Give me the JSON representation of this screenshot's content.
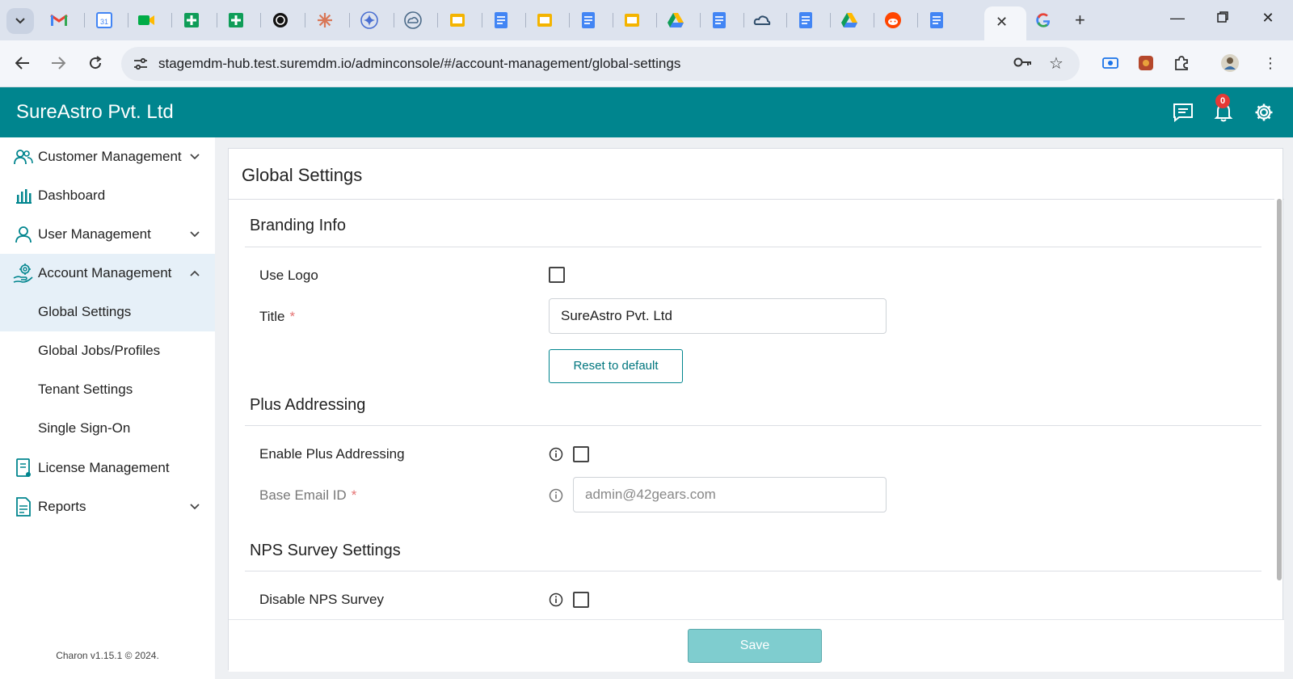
{
  "browser": {
    "url": "stagemdm-hub.test.suremdm.io/adminconsole/#/account-management/global-settings",
    "tab_favicons": [
      "gmail-icon",
      "calendar-icon",
      "meet-icon",
      "sheets-icon",
      "sheets-icon",
      "openai-icon",
      "claude-icon",
      "gemini-icon",
      "cloud-icon",
      "slides-icon",
      "docs-icon",
      "slides-icon",
      "docs-icon",
      "slides-icon",
      "drive-icon",
      "docs-icon",
      "cloud-icon",
      "docs-icon",
      "drive-icon",
      "reddit-icon",
      "docs-icon"
    ],
    "calendar_day": "31"
  },
  "app": {
    "brand": "SureAstro Pvt. Ltd",
    "notification_count": "0",
    "accent_color": "#00858e"
  },
  "sidebar": {
    "items": [
      {
        "label": "Customer Management",
        "icon": "users-icon",
        "chevron": "down"
      },
      {
        "label": "Dashboard",
        "icon": "bar-chart-icon"
      },
      {
        "label": "User Management",
        "icon": "user-icon",
        "chevron": "down"
      },
      {
        "label": "Account Management",
        "icon": "account-gear-icon",
        "chevron": "up"
      },
      {
        "label": "Global Settings"
      },
      {
        "label": "Global Jobs/Profiles"
      },
      {
        "label": "Tenant Settings"
      },
      {
        "label": "Single Sign-On"
      },
      {
        "label": "License Management",
        "icon": "license-icon"
      },
      {
        "label": "Reports",
        "icon": "report-icon",
        "chevron": "down"
      }
    ],
    "footer": "Charon v1.15.1 © 2024."
  },
  "page": {
    "title": "Global Settings",
    "branding": {
      "heading": "Branding Info",
      "use_logo_label": "Use Logo",
      "title_label": "Title",
      "title_value": "SureAstro Pvt. Ltd",
      "reset_label": "Reset to default"
    },
    "plus": {
      "heading": "Plus Addressing",
      "enable_label": "Enable Plus Addressing",
      "base_email_label": "Base Email ID",
      "base_email_placeholder": "admin@42gears.com"
    },
    "nps": {
      "heading": "NPS Survey Settings",
      "disable_label": "Disable NPS Survey"
    },
    "required_mark": "*",
    "save_label": "Save"
  }
}
